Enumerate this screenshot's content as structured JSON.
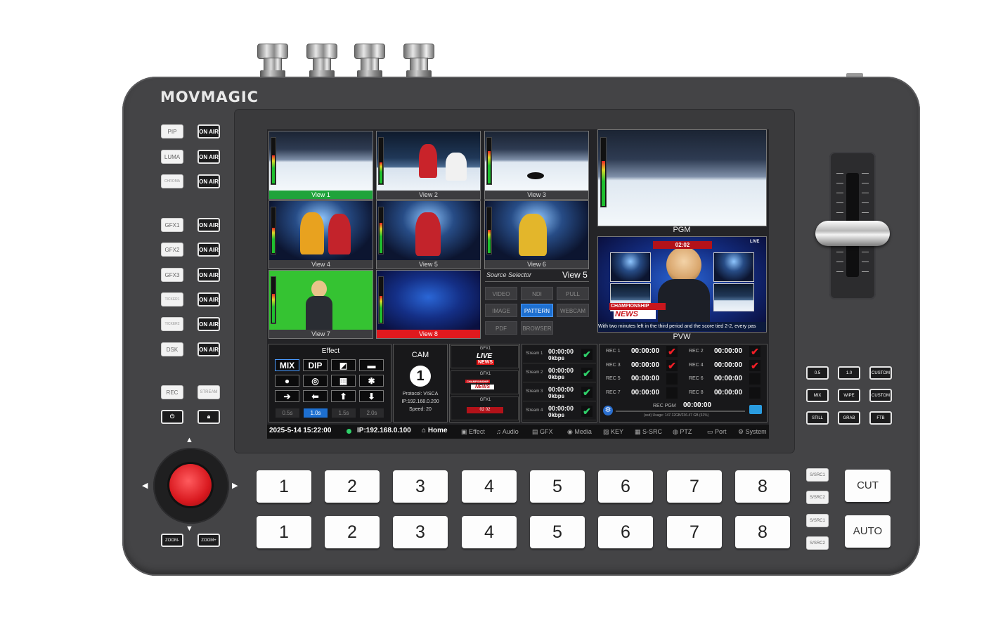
{
  "brand": "MOVMAGIC",
  "left_keys": [
    {
      "label": "PIP",
      "onair": "ON AIR"
    },
    {
      "label": "LUMA",
      "onair": "ON AIR"
    },
    {
      "label": "CHROMA",
      "onair": "ON AIR"
    },
    {
      "label": "GFX1",
      "onair": "ON AIR"
    },
    {
      "label": "GFX2",
      "onair": "ON AIR"
    },
    {
      "label": "GFX3",
      "onair": "ON AIR"
    },
    {
      "label": "TICKER1",
      "onair": "ON AIR"
    },
    {
      "label": "TICKER2",
      "onair": "ON AIR"
    },
    {
      "label": "DSK",
      "onair": "ON AIR"
    }
  ],
  "rec_key": "REC",
  "stream_key": "STREAM",
  "zoom_minus": "ZOOM-",
  "zoom_plus": "ZOOM+",
  "views": [
    "View 1",
    "View 2",
    "View 3",
    "View 4",
    "View 5",
    "View 6",
    "View 7",
    "View 8"
  ],
  "pgm_label": "PGM",
  "pvw_label": "PVW",
  "pvw_overlay": {
    "score": "02:02",
    "live": "LIVE",
    "news_top": "CHAMPIONSHIP",
    "news": "NEWS",
    "ticker": "With two minutes left in the third period and the score tied 2-2, every pas"
  },
  "source_selector": {
    "title": "Source Selector",
    "current": "View 5",
    "buttons": [
      "VIDEO",
      "NDI",
      "PULL",
      "IMAGE",
      "PATTERN",
      "WEBCAM",
      "PDF",
      "BROWSER"
    ],
    "active": "PATTERN"
  },
  "effect": {
    "title": "Effect",
    "mix": "MIX",
    "dip": "DIP",
    "speeds": [
      "0.5s",
      "1.0s",
      "1.5s",
      "2.0s"
    ],
    "active_speed": "1.0s"
  },
  "cam": {
    "title": "CAM",
    "number": "1",
    "protocol": "Protocol:  VISCA",
    "ip": "IP:192.168.0.200",
    "speed": "Speed:  20"
  },
  "gfx": [
    {
      "label": "GFX1",
      "line1": "LIVE",
      "line2": "NEWS"
    },
    {
      "label": "GFX1",
      "line1": "CHAMPIONSHIP",
      "line2": "NEWS"
    },
    {
      "label": "GFX1",
      "line1": "02 02",
      "line2": ""
    }
  ],
  "streams": [
    {
      "label": "Stream 1",
      "time": "00:00:00",
      "rate": "0kbps"
    },
    {
      "label": "Stream 2",
      "time": "00:00:00",
      "rate": "0kbps"
    },
    {
      "label": "Stream 3",
      "time": "00:00:00",
      "rate": "0kbps"
    },
    {
      "label": "Stream 4",
      "time": "00:00:00",
      "rate": "0kbps"
    }
  ],
  "recs": [
    {
      "label": "REC 1",
      "time": "00:00:00",
      "checked": true
    },
    {
      "label": "REC 2",
      "time": "00:00:00",
      "checked": true
    },
    {
      "label": "REC 3",
      "time": "00:00:00",
      "checked": true
    },
    {
      "label": "REC 4",
      "time": "00:00:00",
      "checked": true
    },
    {
      "label": "REC 5",
      "time": "00:00:00",
      "checked": false
    },
    {
      "label": "REC 6",
      "time": "00:00:00",
      "checked": false
    },
    {
      "label": "REC 7",
      "time": "00:00:00",
      "checked": false
    },
    {
      "label": "REC 8",
      "time": "00:00:00",
      "checked": false
    }
  ],
  "rec_pgm": {
    "label": "REC PGM",
    "time": "00:00:00",
    "usage": "(ssd)  Usage:  147.12GB/236.47 GB  (61%)"
  },
  "status": {
    "datetime": "2025-5-14 15:22:00",
    "ip": "IP:192.168.0.100"
  },
  "nav": [
    "Home",
    "Effect",
    "Audio",
    "GFX",
    "Media",
    "KEY",
    "S-SRC",
    "PTZ",
    "Port",
    "System"
  ],
  "right_keys": [
    "0.5",
    "1.0",
    "CUSTOM",
    "MIX",
    "WIPE",
    "CUSTOM",
    "STILL",
    "GRAB",
    "FTB"
  ],
  "row_pgm": [
    "1",
    "2",
    "3",
    "4",
    "5",
    "6",
    "7",
    "8"
  ],
  "row_pvw": [
    "1",
    "2",
    "3",
    "4",
    "5",
    "6",
    "7",
    "8"
  ],
  "ssrc": [
    "S/SRC1",
    "S/SRC2",
    "S/SRC1",
    "S/SRC2"
  ],
  "cut": "CUT",
  "auto": "AUTO",
  "colors": {
    "accent": "#1d6fd0",
    "onair_green": "#1fa33b",
    "live_red": "#e0191e"
  }
}
